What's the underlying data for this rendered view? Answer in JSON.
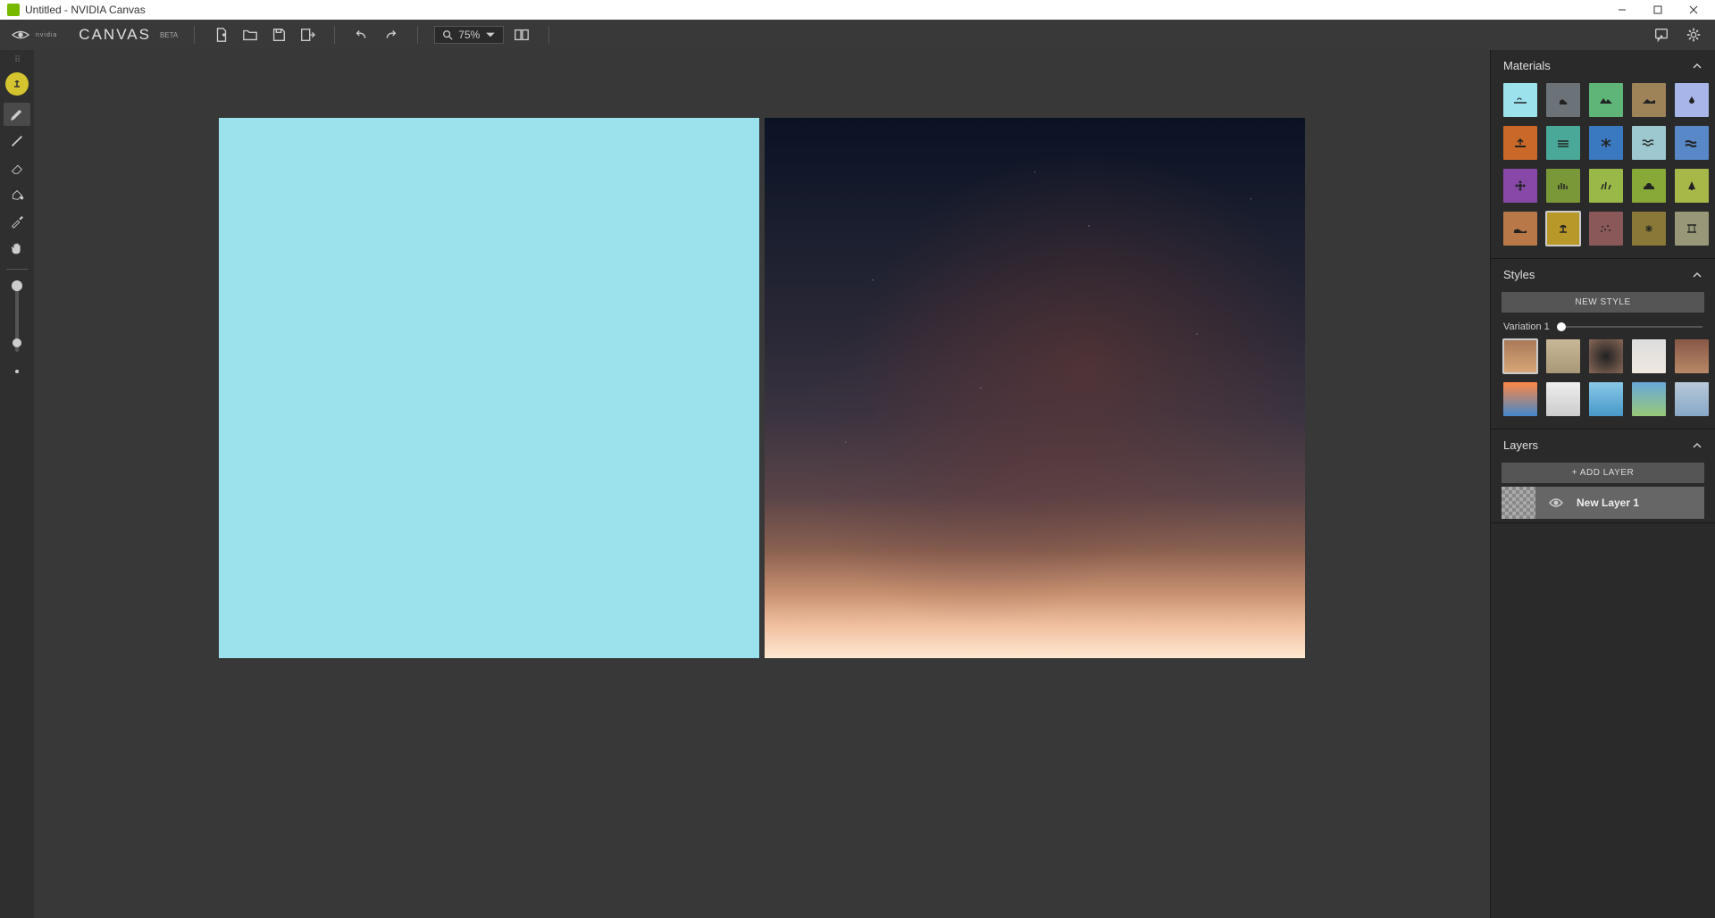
{
  "titlebar": {
    "title": "Untitled - NVIDIA Canvas"
  },
  "brand": {
    "logo_text": "nvidia",
    "app_name": "CANVAS",
    "beta": "BETA"
  },
  "toolbar": {
    "zoom": "75%"
  },
  "panels": {
    "materials": {
      "title": "Materials"
    },
    "styles": {
      "title": "Styles",
      "new_style_btn": "NEW STYLE",
      "variation_label": "Variation 1"
    },
    "layers": {
      "title": "Layers",
      "add_btn": "+ ADD LAYER",
      "items": [
        {
          "name": "New Layer 1"
        }
      ]
    }
  },
  "materials_palette": [
    {
      "name": "sky",
      "color": "#9ce2ed",
      "icon": "cloud-line"
    },
    {
      "name": "cloud",
      "color": "#6b7278",
      "icon": "cloud"
    },
    {
      "name": "mountain",
      "color": "#5fb578",
      "icon": "mountain"
    },
    {
      "name": "hill",
      "color": "#9e8258",
      "icon": "hill"
    },
    {
      "name": "water-drop",
      "color": "#a8b5e8",
      "icon": "drop"
    },
    {
      "name": "dirt",
      "color": "#c96828",
      "icon": "ground-arrow"
    },
    {
      "name": "fog",
      "color": "#4aa898",
      "icon": "fog"
    },
    {
      "name": "snow",
      "color": "#3a78c0",
      "icon": "snowflake"
    },
    {
      "name": "water-1",
      "color": "#9dc8d0",
      "icon": "waves1"
    },
    {
      "name": "water-2",
      "color": "#5888c8",
      "icon": "waves2"
    },
    {
      "name": "flower",
      "color": "#8848a8",
      "icon": "flower"
    },
    {
      "name": "grass-1",
      "color": "#7a9838",
      "icon": "grass1"
    },
    {
      "name": "grass-2",
      "color": "#9ab848",
      "icon": "grass2"
    },
    {
      "name": "bush",
      "color": "#88a838",
      "icon": "bush"
    },
    {
      "name": "tree",
      "color": "#a8b848",
      "icon": "pine"
    },
    {
      "name": "sand",
      "color": "#b87848",
      "icon": "sand"
    },
    {
      "name": "tree-2",
      "color": "#b89828",
      "icon": "palmtree",
      "selected": true
    },
    {
      "name": "rock-1",
      "color": "#8a5858",
      "icon": "dots"
    },
    {
      "name": "rock-2",
      "color": "#8a7838",
      "icon": "sparkle"
    },
    {
      "name": "building",
      "color": "#989878",
      "icon": "pillar"
    }
  ],
  "styles_palette": [
    {
      "name": "desert-arch",
      "bg": "linear-gradient(#a87858,#d8a878)",
      "selected": true
    },
    {
      "name": "beach",
      "bg": "linear-gradient(#c8b898,#a89878)"
    },
    {
      "name": "cave",
      "bg": "radial-gradient(#222,#886858)"
    },
    {
      "name": "snowy-peak",
      "bg": "linear-gradient(#ddd,#f0e8e0)"
    },
    {
      "name": "rocky-mtn",
      "bg": "linear-gradient(#885848,#b88868)"
    },
    {
      "name": "sunset",
      "bg": "linear-gradient(#ff8844,#4488cc)"
    },
    {
      "name": "winter",
      "bg": "linear-gradient(#eee,#ccc)"
    },
    {
      "name": "lake",
      "bg": "linear-gradient(#88c8e8,#4898c8)"
    },
    {
      "name": "alpine",
      "bg": "linear-gradient(#68a8d8,#98c878)"
    },
    {
      "name": "coast",
      "bg": "linear-gradient(#b8c8d8,#88a8c8)"
    }
  ]
}
